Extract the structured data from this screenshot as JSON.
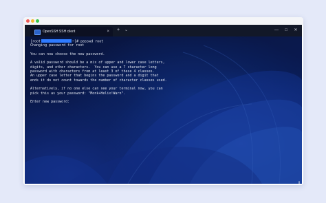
{
  "tab": {
    "title": "OpenSSH SSH client",
    "icon": "terminal-icon",
    "close_glyph": "×",
    "new_tab_glyph": "+",
    "dropdown_glyph": "⌄"
  },
  "window_controls": {
    "minimize": "—",
    "maximize": "□",
    "close": "✕"
  },
  "terminal": {
    "prompt_prefix": "[root",
    "prompt_suffix": "~]# passwd root",
    "lines": [
      "Changing password for root",
      "",
      "You can now choose the new password.",
      "",
      "A valid password should be a mix of upper and lower case letters,",
      "digits, and other characters.  You can use a 7 character long",
      "password with characters from at least 3 of these 4 classes.",
      "An upper case letter that begins the password and a digit that",
      "ends it do not count towards the number of character classes used.",
      "",
      "Alternatively, if no one else can see your terminal now, you can",
      "pick this as your password: \"Monk+Helix!Warn\".",
      "",
      "Enter new password:"
    ]
  },
  "colors": {
    "page_bg": "#e4e9f9",
    "redaction": "#2f7bff",
    "terminal_text": "#dfe4ef",
    "mac_red": "#ef5b55",
    "mac_yellow": "#f2b92e",
    "mac_green": "#35c649"
  }
}
